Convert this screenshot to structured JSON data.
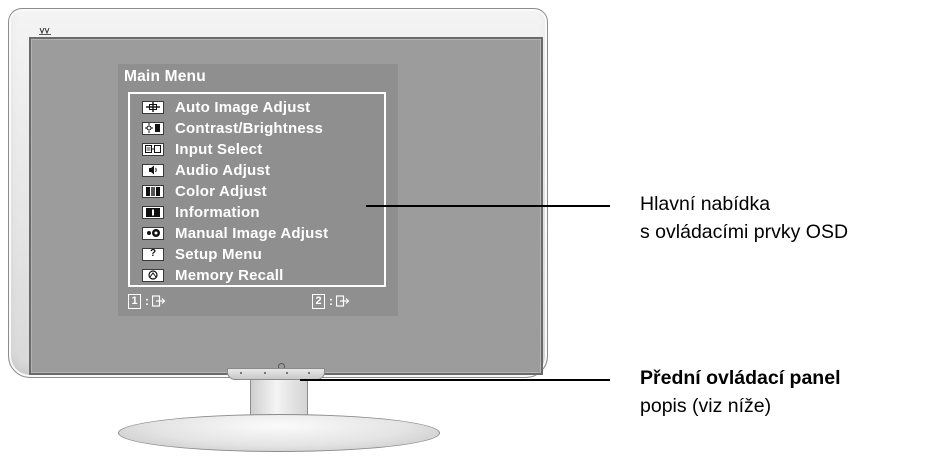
{
  "osd": {
    "title": "Main Menu",
    "items": [
      {
        "label": "Auto Image Adjust",
        "icon": "crosshair-icon"
      },
      {
        "label": "Contrast/Brightness",
        "icon": "contrast-brightness-icon"
      },
      {
        "label": "Input Select",
        "icon": "input-select-icon"
      },
      {
        "label": "Audio Adjust",
        "icon": "speaker-icon"
      },
      {
        "label": "Color Adjust",
        "icon": "color-bars-icon"
      },
      {
        "label": "Information",
        "icon": "info-icon"
      },
      {
        "label": "Manual Image Adjust",
        "icon": "manual-adjust-icon"
      },
      {
        "label": "Setup Menu",
        "icon": "question-icon"
      },
      {
        "label": "Memory Recall",
        "icon": "memory-recall-icon"
      }
    ],
    "footer": [
      {
        "key": "1",
        "sep": ":",
        "icon": "exit-icon"
      },
      {
        "key": "2",
        "sep": ":",
        "icon": "enter-icon"
      }
    ]
  },
  "callouts": {
    "main_menu": {
      "line1": "Hlavní nabídka",
      "line2": "s ovládacími prvky OSD"
    },
    "front_panel": {
      "line1": "Přední ovládací panel",
      "line2": "popis (viz níže)"
    }
  }
}
